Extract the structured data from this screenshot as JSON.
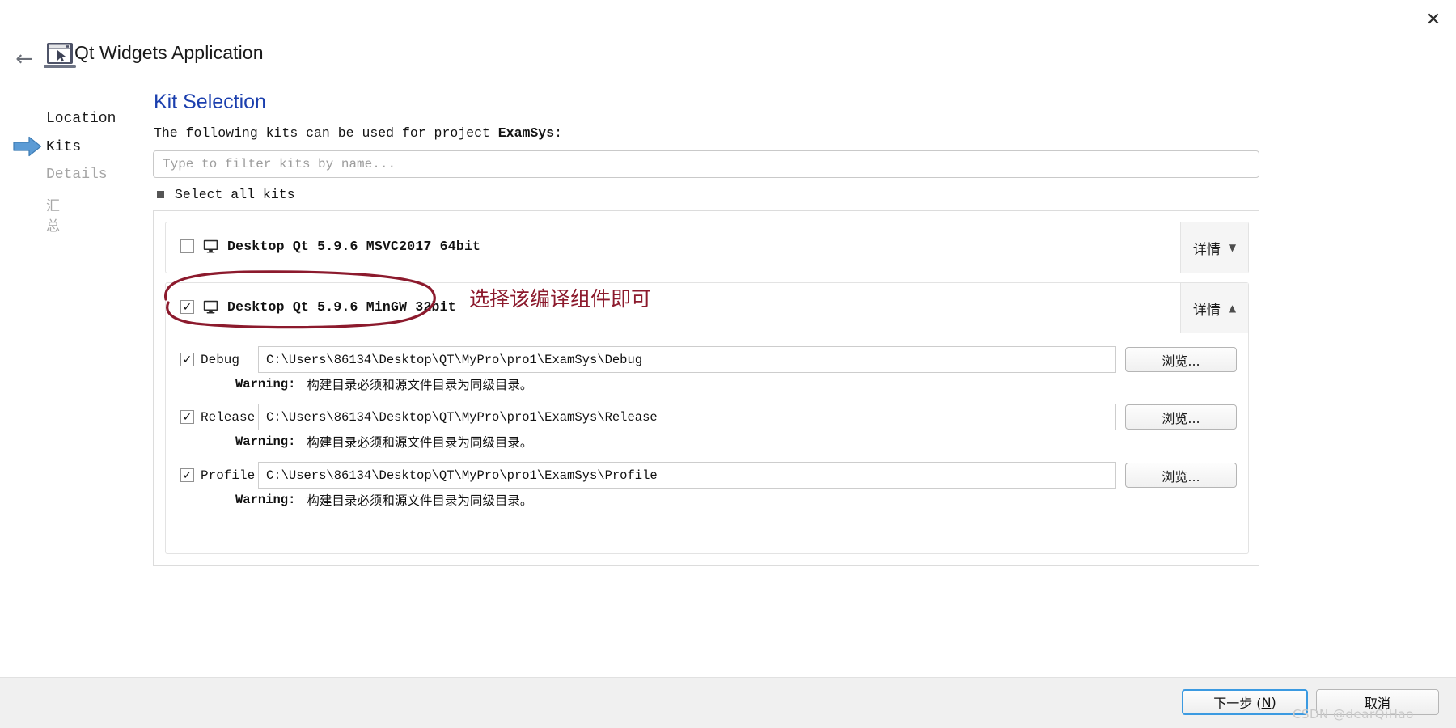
{
  "window": {
    "title": "Qt Widgets Application",
    "close_icon": "close-icon",
    "back_icon": "back-arrow-icon",
    "app_icon": "laptop-cursor-icon"
  },
  "sidebar": {
    "items": [
      {
        "label": "Location",
        "state": "done"
      },
      {
        "label": "Kits",
        "state": "current"
      },
      {
        "label": "Details",
        "state": "pending"
      },
      {
        "label": "汇总",
        "state": "pending"
      }
    ],
    "current_marker_icon": "blue-arrow-icon"
  },
  "main": {
    "page_title": "Kit Selection",
    "description_prefix": "The following kits can be used for project ",
    "description_project": "ExamSys",
    "description_suffix": ":",
    "filter_placeholder": "Type to filter kits by name...",
    "filter_value": "",
    "select_all_label": "Select all kits",
    "select_all_state": "partial"
  },
  "kits": [
    {
      "name": "Desktop Qt 5.9.6 MSVC2017 64bit",
      "checked": false,
      "icon": "monitor-icon",
      "details_label": "详情",
      "details_caret": "▼",
      "expanded": false,
      "configs": []
    },
    {
      "name": "Desktop Qt 5.9.6 MinGW 32bit",
      "checked": true,
      "icon": "monitor-icon",
      "details_label": "详情",
      "details_caret": "▲",
      "expanded": true,
      "configs": [
        {
          "label": "Debug",
          "checked": true,
          "path": "C:\\Users\\86134\\Desktop\\QT\\MyPro\\pro1\\ExamSys\\Debug",
          "browse_label": "浏览...",
          "warning_keyword": "Warning:",
          "warning_message": "构建目录必须和源文件目录为同级目录。"
        },
        {
          "label": "Release",
          "checked": true,
          "path": "C:\\Users\\86134\\Desktop\\QT\\MyPro\\pro1\\ExamSys\\Release",
          "browse_label": "浏览...",
          "warning_keyword": "Warning:",
          "warning_message": "构建目录必须和源文件目录为同级目录。"
        },
        {
          "label": "Profile",
          "checked": true,
          "path": "C:\\Users\\86134\\Desktop\\QT\\MyPro\\pro1\\ExamSys\\Profile",
          "browse_label": "浏览...",
          "warning_keyword": "Warning:",
          "warning_message": "构建目录必须和源文件目录为同级目录。"
        }
      ]
    }
  ],
  "annotation": {
    "text": "选择该编译组件即可",
    "color": "#8c1a2d"
  },
  "footer": {
    "next_label_main": "下一步 (",
    "next_label_key": "N",
    "next_label_end": ")",
    "cancel_label": "取消"
  },
  "watermark": "CSDN @dearQiHao",
  "colors": {
    "accent_title": "#1b3fae",
    "annotation_red": "#8c1a2d",
    "primary_button_border": "#3b9ae1",
    "footer_bg": "#f0f0f0"
  }
}
